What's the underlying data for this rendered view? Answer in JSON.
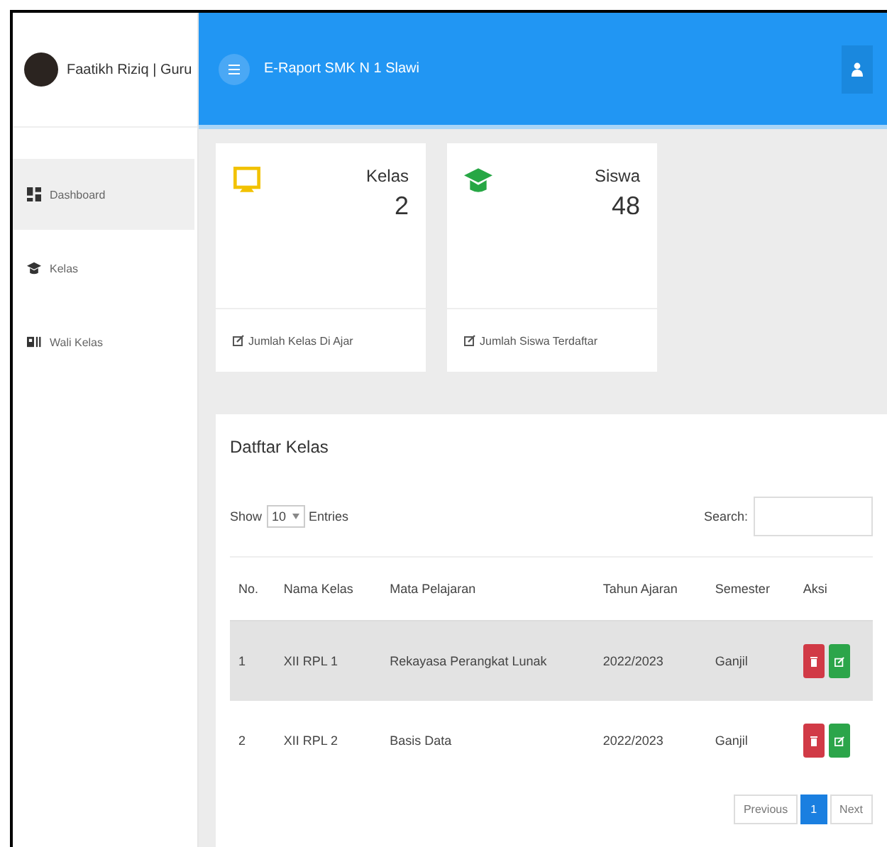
{
  "user": {
    "name": "Faatikh Riziq | Guru"
  },
  "sidebar": {
    "items": [
      {
        "label": "Dashboard",
        "kind": "grid",
        "selected": true
      },
      {
        "label": "Kelas",
        "kind": "cap",
        "selected": false
      },
      {
        "label": "Wali Kelas",
        "kind": "id",
        "selected": false
      }
    ]
  },
  "header": {
    "title": "E-Raport SMK N 1 Slawi"
  },
  "cards": [
    {
      "kind": "screen",
      "color": "#f2c200",
      "title": "Kelas",
      "value": "2",
      "footer": "Jumlah Kelas Di Ajar"
    },
    {
      "kind": "cap",
      "color": "#27a745",
      "title": "Siswa",
      "value": "48",
      "footer": "Jumlah Siswa Terdaftar"
    }
  ],
  "table_panel": {
    "title": "Datftar Kelas",
    "show_label": "Show",
    "page_size": "10",
    "entries_label": "Entries",
    "search_label": "Search:",
    "columns": [
      "No.",
      "Nama Kelas",
      "Mata Pelajaran",
      "Tahun Ajaran",
      "Semester",
      "Aksi"
    ],
    "rows": [
      {
        "cells": [
          "1",
          "XII RPL 1",
          "Rekayasa Perangkat Lunak",
          "2022/2023",
          "Ganjil"
        ],
        "selected": true
      },
      {
        "cells": [
          "2",
          "XII RPL 2",
          "Basis Data",
          "2022/2023",
          "Ganjil"
        ],
        "selected": false
      }
    ],
    "pagination": [
      {
        "label": "Previous",
        "selected": false
      },
      {
        "label": "1",
        "selected": true
      },
      {
        "label": "Next",
        "selected": false
      }
    ]
  }
}
